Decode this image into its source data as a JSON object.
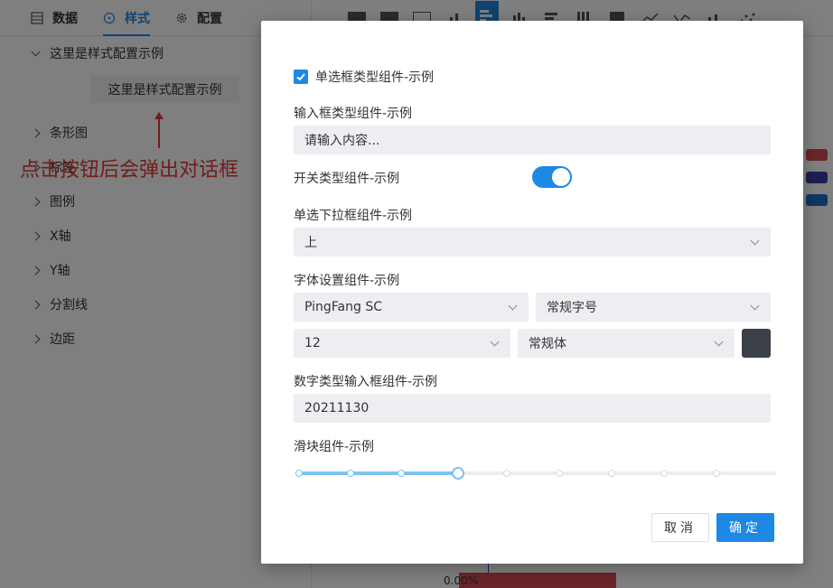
{
  "left_panel": {
    "tabs": [
      {
        "label": "数据",
        "icon": "table-icon"
      },
      {
        "label": "样式",
        "icon": "palette-icon"
      },
      {
        "label": "配置",
        "icon": "gear-icon"
      }
    ],
    "expanded_section": "这里是样式配置示例",
    "demo_button": "这里是样式配置示例",
    "annotation": "点击按钮后会弹出对话框",
    "sections": [
      "条形图",
      "标签",
      "图例",
      "X轴",
      "Y轴",
      "分割线",
      "边距"
    ]
  },
  "chart_preview": {
    "x_value_label": "0.00%",
    "legend_colors": [
      "#d24b54",
      "#3a3aa6",
      "#1e6fc2"
    ]
  },
  "dialog": {
    "checkbox_label": "单选框类型组件-示例",
    "checkbox_checked": true,
    "input_label": "输入框类型组件-示例",
    "input_placeholder": "请输入内容...",
    "switch_label": "开关类型组件-示例",
    "switch_on": true,
    "select_label": "单选下拉框组件-示例",
    "select_value": "上",
    "font_label": "字体设置组件-示例",
    "font_family": "PingFang SC",
    "font_size_name": "常规字号",
    "font_size": "12",
    "font_weight": "常规体",
    "font_color": "#3c4048",
    "number_label": "数字类型输入框组件-示例",
    "number_value": "20211130",
    "slider_label": "滑块组件-示例",
    "slider_value": 0.33,
    "cancel_label": "取消",
    "ok_label": "确定"
  },
  "colors": {
    "accent": "#1e88e5",
    "annotation": "#e53935"
  }
}
